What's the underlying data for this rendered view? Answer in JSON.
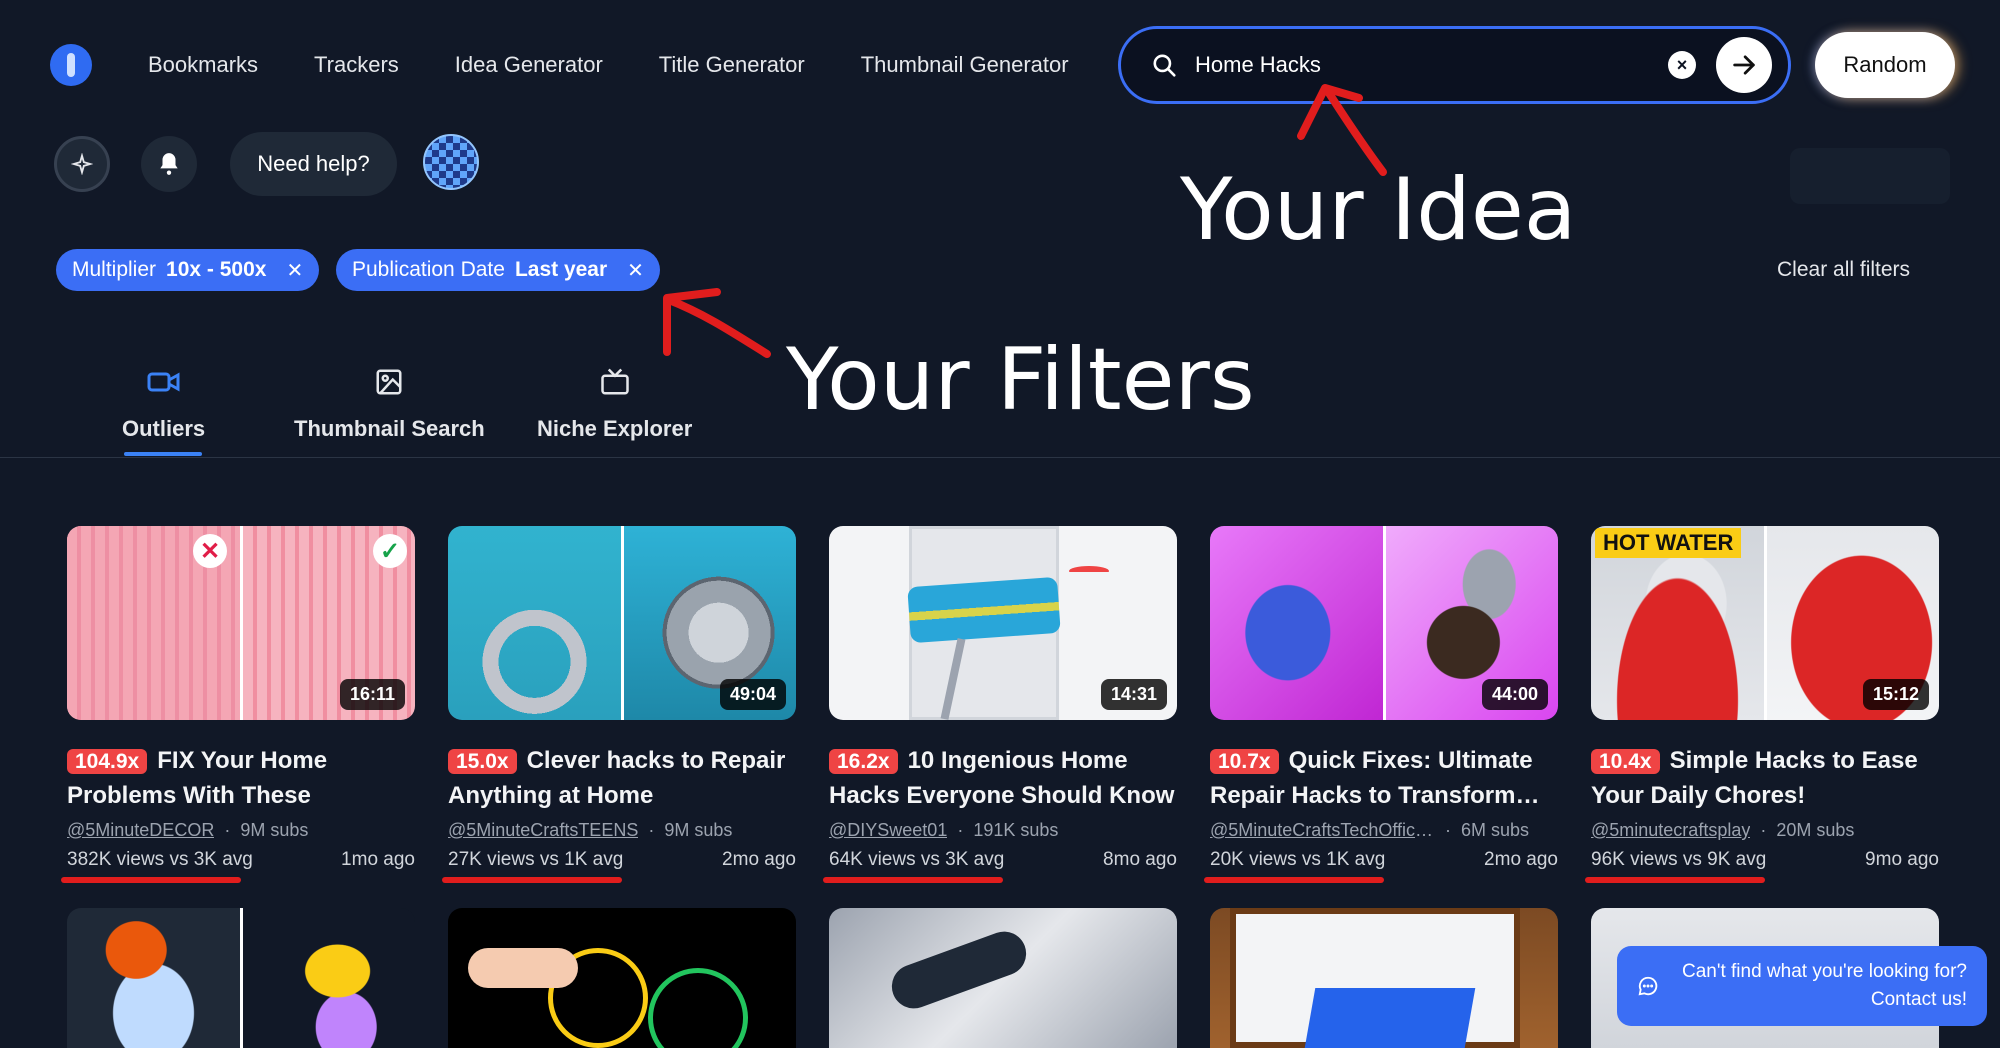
{
  "nav": {
    "items": [
      "Bookmarks",
      "Trackers",
      "Idea Generator",
      "Title Generator",
      "Thumbnail Generator"
    ]
  },
  "search": {
    "value": "Home Hacks",
    "clear_icon": "close-circle-icon",
    "go_icon": "arrow-right-icon"
  },
  "random_label": "Random",
  "toolbar": {
    "help_label": "Need help?"
  },
  "annotations": {
    "idea": "Your Idea",
    "filters": "Your Filters"
  },
  "filters": {
    "chips": [
      {
        "name": "Multiplier",
        "value": "10x - 500x"
      },
      {
        "name": "Publication Date",
        "value": "Last year"
      }
    ],
    "clear_label": "Clear all filters"
  },
  "tabs": [
    {
      "label": "Outliers",
      "icon": "video-camera-icon",
      "active": true
    },
    {
      "label": "Thumbnail Search",
      "icon": "image-icon",
      "active": false
    },
    {
      "label": "Niche Explorer",
      "icon": "tv-icon",
      "active": false
    }
  ],
  "cards": [
    {
      "multiplier": "104.9x",
      "title": "FIX Your Home Problems With These GENIUS…",
      "channel": "@5MinuteDECOR",
      "subs": "9M subs",
      "stats": "382K views vs 3K avg",
      "ago": "1mo ago",
      "duration": "16:11"
    },
    {
      "multiplier": "15.0x",
      "title": "Clever hacks to Repair Anything at Home",
      "channel": "@5MinuteCraftsTEENS",
      "subs": "9M subs",
      "stats": "27K views vs 1K avg",
      "ago": "2mo ago",
      "duration": "49:04"
    },
    {
      "multiplier": "16.2x",
      "title": "10 Ingenious Home Hacks Everyone Should Know",
      "channel": "@DIYSweet01",
      "subs": "191K subs",
      "stats": "64K views vs 3K avg",
      "ago": "8mo ago",
      "duration": "14:31"
    },
    {
      "multiplier": "10.7x",
      "title": "Quick Fixes: Ultimate Repair Hacks to Transform…",
      "channel": "@5MinuteCraftsTechOffici…",
      "subs": "6M subs",
      "stats": "20K views vs 1K avg",
      "ago": "2mo ago",
      "duration": "44:00"
    },
    {
      "multiplier": "10.4x",
      "title": "Simple Hacks to Ease Your Daily Chores!",
      "channel": "@5minutecraftsplay",
      "subs": "20M subs",
      "stats": "96K views vs 9K avg",
      "ago": "9mo ago",
      "duration": "15:12"
    }
  ],
  "thumb_overlay": {
    "hot_water": "HOT WATER"
  },
  "contact": {
    "line1": "Can't find what you're looking for?",
    "line2": "Contact us!"
  },
  "colors": {
    "accent": "#3b6ef5",
    "multiplier": "#ef4444",
    "annotation": "#e11d1d",
    "background": "#111827"
  }
}
